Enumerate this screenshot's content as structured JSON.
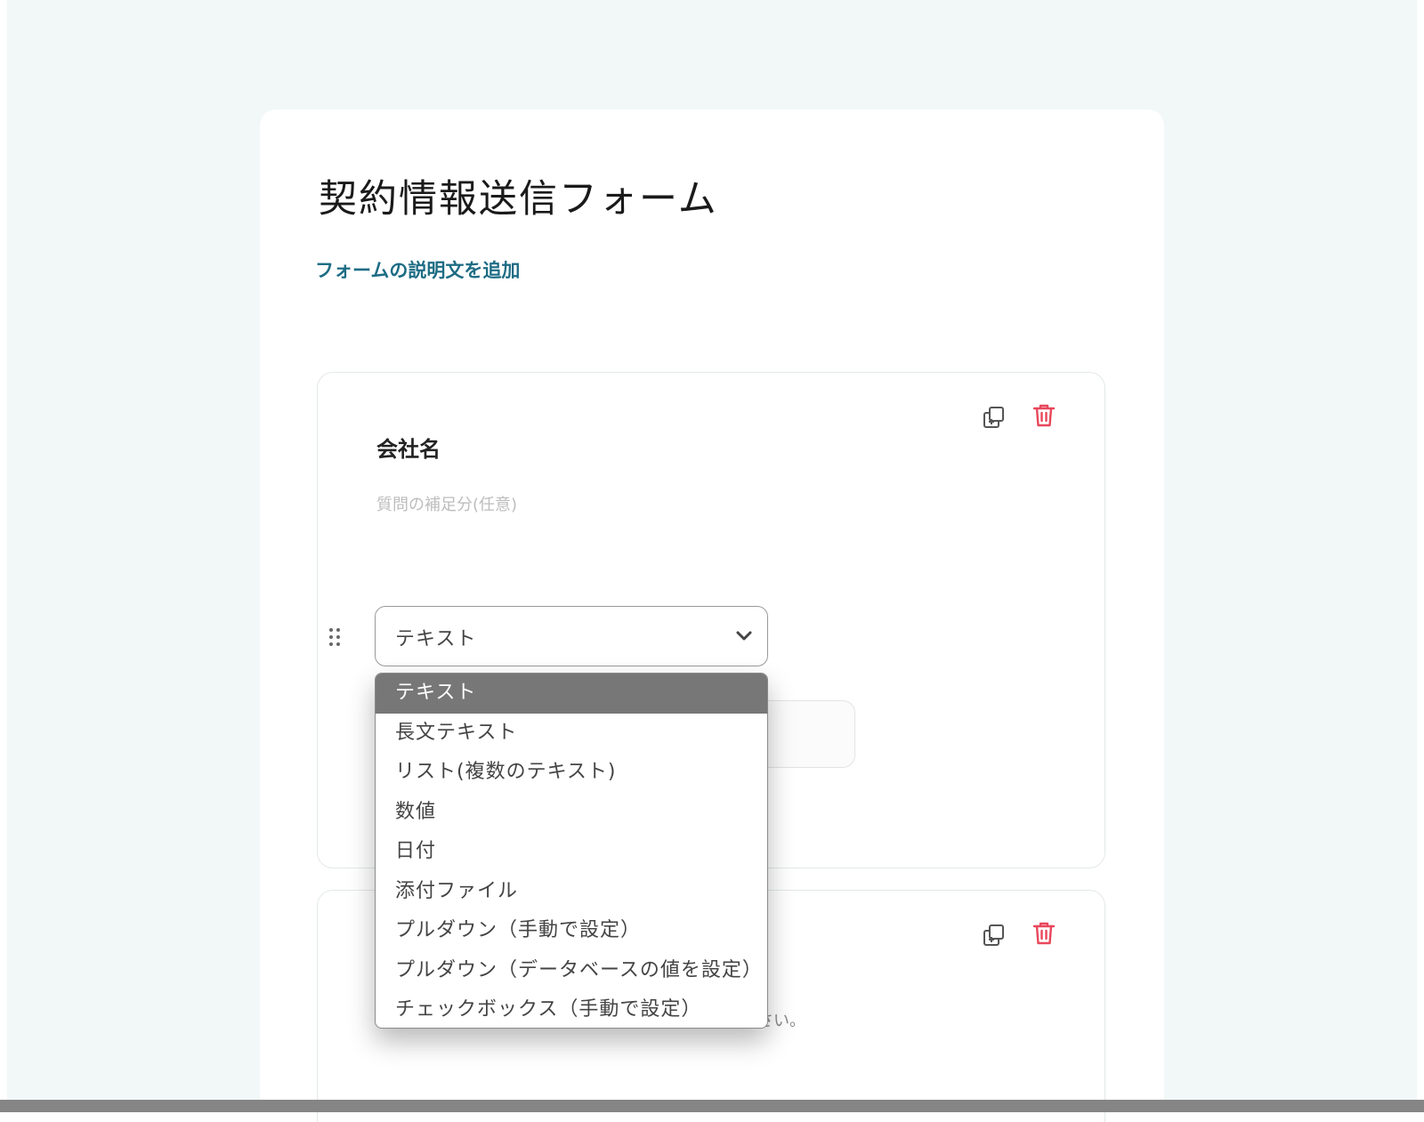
{
  "form": {
    "title": "契約情報送信フォーム",
    "add_description_link": "フォームの説明文を追加"
  },
  "questions": [
    {
      "title": "会社名",
      "help_placeholder": "質問の補足分(任意)",
      "type_select": {
        "value": "テキスト"
      }
    },
    {
      "help_text_visible_tail": "さい。"
    }
  ],
  "type_dropdown": {
    "options": [
      "テキスト",
      "長文テキスト",
      "リスト(複数のテキスト)",
      "数値",
      "日付",
      "添付ファイル",
      "プルダウン（手動で設定）",
      "プルダウン（データベースの値を設定）",
      "チェックボックス（手動で設定）"
    ],
    "selected_index": 0
  },
  "icons": {
    "duplicate": "duplicate-icon",
    "delete": "trash-icon",
    "drag": "drag-handle-icon",
    "chevron": "chevron-down-icon"
  },
  "colors": {
    "link": "#1d6c84",
    "delete_icon": "#e8475b",
    "page_background": "#f1f8f7",
    "selected_option": "#777777"
  }
}
